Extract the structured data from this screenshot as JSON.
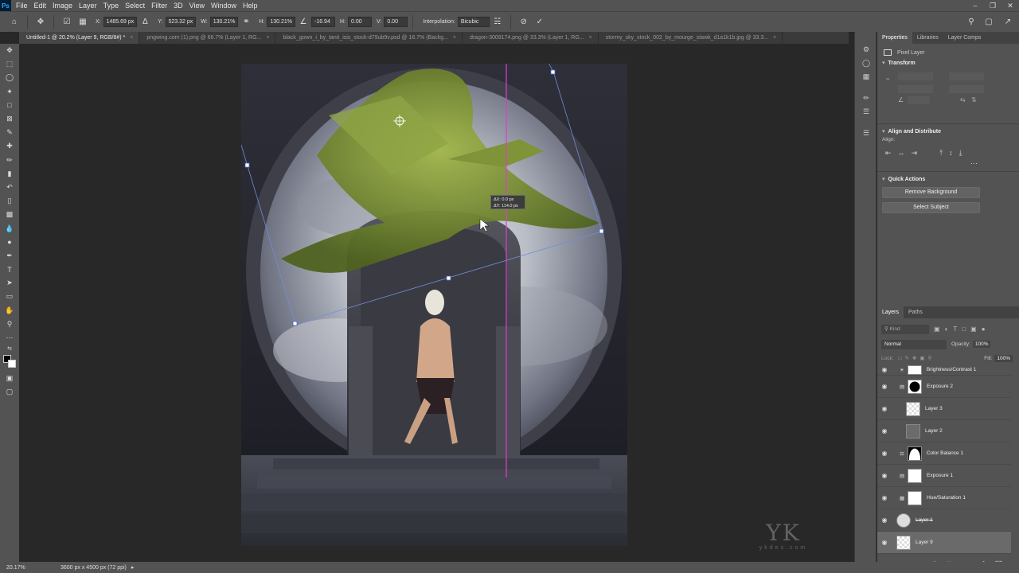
{
  "menubar": {
    "logo": "Ps",
    "items": [
      "File",
      "Edit",
      "Image",
      "Layer",
      "Type",
      "Select",
      "Filter",
      "3D",
      "View",
      "Window",
      "Help"
    ]
  },
  "options": {
    "x_label": "X:",
    "x_value": "1485.69 px",
    "y_label": "Y:",
    "y_value": "523.32 px",
    "w_label": "W:",
    "w_value": "130.21%",
    "h_label": "H:",
    "h_value": "130.21%",
    "angle_value": "-16.94",
    "hskew_label": "H:",
    "hskew_value": "0.00",
    "vskew_label": "V:",
    "vskew_value": "0.00",
    "interp_label": "Interpolation:",
    "interp_value": "Bicubic"
  },
  "tabs": [
    {
      "label": "Untitled-1 @ 20.2% (Layer 9, RGB/8#) *"
    },
    {
      "label": "pngwing.com (1).png @ 66.7% (Layer 1, RG..."
    },
    {
      "label": "black_gown_i_by_tanit_isis_stock-d79ub9v.psd @ 16.7% (Backg..."
    },
    {
      "label": "dragon-3009174.png @ 33.3% (Layer 1, RG..."
    },
    {
      "label": "stormy_sky_stock_002_by_mourge_stawk_d1a1k1b.jpg @ 33.3..."
    }
  ],
  "transform_readout": {
    "dx": "0.0 px",
    "dy": "114.0 px"
  },
  "watermark": "ykdes.com",
  "properties": {
    "tabs": [
      "Properties",
      "Libraries",
      "Layer Comps"
    ],
    "kind": "Pixel Layer",
    "transform_title": "Transform",
    "align_title": "Align and Distribute",
    "align_label": "Align:",
    "quick_title": "Quick Actions",
    "btn_remove_bg": "Remove Background",
    "btn_select_subject": "Select Subject"
  },
  "layers_panel": {
    "tabs": [
      "Layers",
      "Paths"
    ],
    "kind_placeholder": "Kind",
    "blend_mode": "Normal",
    "opacity_label": "Opacity:",
    "opacity_value": "100%",
    "lock_label": "Lock:",
    "fill_label": "Fill:",
    "fill_value": "100%",
    "layers": [
      {
        "name": "Brightness/Contrast 1"
      },
      {
        "name": "Exposure 2"
      },
      {
        "name": "Layer 3"
      },
      {
        "name": "Layer 2"
      },
      {
        "name": "Color Balance 1"
      },
      {
        "name": "Exposure 1"
      },
      {
        "name": "Hue/Saturation 1"
      },
      {
        "name": "Layer 1"
      },
      {
        "name": "Layer 9"
      }
    ]
  },
  "status": {
    "zoom": "20.17%",
    "doc_info": "3600 px x 4500 px (72 ppi)"
  }
}
